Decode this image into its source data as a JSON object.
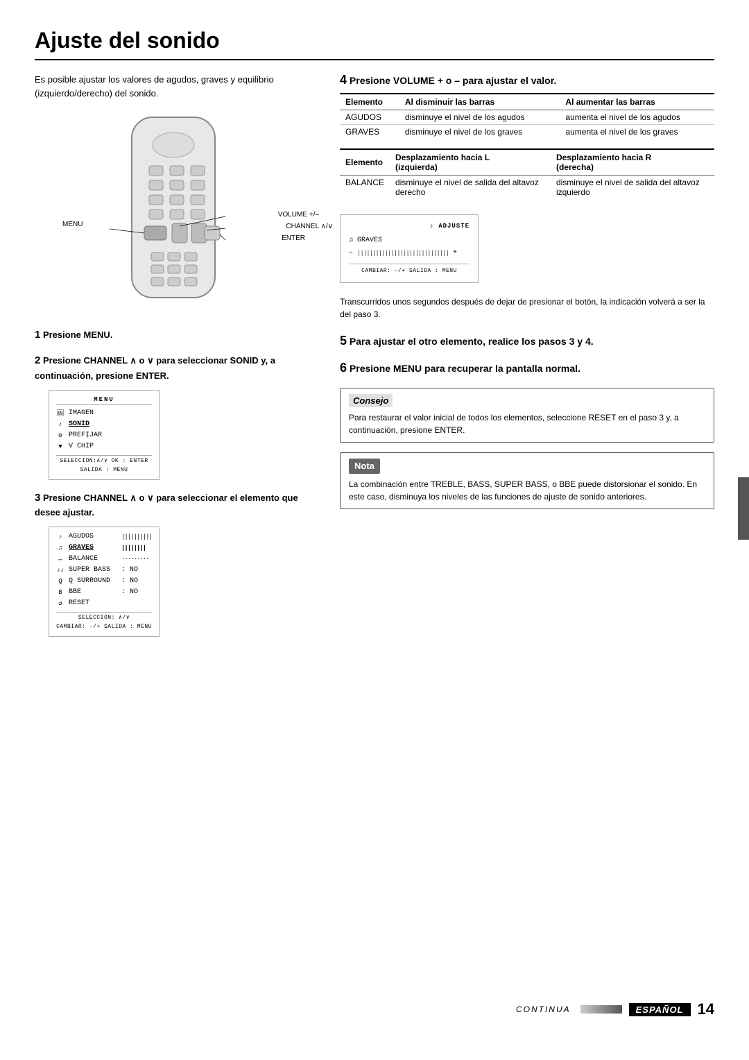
{
  "page": {
    "title": "Ajuste del sonido",
    "intro": "Es posible ajustar los valores de agudos, graves y equilibrio (izquierdo/derecho) del sonido.",
    "steps": [
      {
        "num": "1",
        "text": "Presione MENU."
      },
      {
        "num": "2",
        "text": "Presione CHANNEL",
        "text2": "o",
        "text3": "para seleccionar SONID y, a continuación, presione ENTER."
      },
      {
        "num": "3",
        "text": "Presione CHANNEL",
        "text2": "o",
        "text3": "para seleccionar el elemento que desee ajustar."
      },
      {
        "num": "4",
        "text": "Presione VOLUME + o – para ajustar el valor."
      },
      {
        "num": "5",
        "text": "Para ajustar el otro elemento, realice los pasos 3 y 4."
      },
      {
        "num": "6",
        "text": "Presione MENU para recuperar la pantalla normal."
      }
    ],
    "remote_labels": {
      "menu": "MENU",
      "volume": "VOLUME +/–",
      "channel": "CHANNEL ∧/∨",
      "enter": "ENTER"
    },
    "screen1": {
      "title": "MENU",
      "rows": [
        {
          "icon": "🖼",
          "label": "IMAGEN",
          "selected": false
        },
        {
          "icon": "♪",
          "label": "SONID",
          "selected": true
        },
        {
          "icon": "⚙",
          "label": "PREFỊJAR",
          "selected": false
        },
        {
          "icon": "▼",
          "label": "V CHIP",
          "selected": false
        }
      ],
      "footer": "SELECCION:∧/∨  OK : ENTER\nSALIDA : MENU"
    },
    "screen2": {
      "rows": [
        {
          "icon": "♪",
          "label": "AGUDOS",
          "bars": "||||||||||",
          "selected": false
        },
        {
          "icon": "♫",
          "label": "GRAVES",
          "bars": "||||||||",
          "selected": true
        },
        {
          "icon": "↔",
          "label": "BALANCE",
          "bars": "·········",
          "selected": false
        },
        {
          "icon": "♪♪",
          "label": "SUPER BASS",
          "value": ": NO",
          "selected": false
        },
        {
          "icon": "Q",
          "label": "Q SURROUND",
          "value": ": NO",
          "selected": false
        },
        {
          "icon": "B",
          "label": "BBE",
          "value": ": NO",
          "selected": false
        },
        {
          "icon": "↺",
          "label": "RESET",
          "value": "",
          "selected": false
        }
      ],
      "footer1": "SELECCION: ∧/∨",
      "footer2": "CAMBIAR: –/+  SALIDA : MENU"
    },
    "table1": {
      "cols": [
        "Elemento",
        "Al disminuir las barras",
        "Al aumentar las barras"
      ],
      "rows": [
        [
          "AGUDOS",
          "disminuye el nivel de los agudos",
          "aumenta el nivel de los agudos"
        ],
        [
          "GRAVES",
          "disminuye el nivel de los graves",
          "aumenta el nivel de los graves"
        ]
      ]
    },
    "table2": {
      "cols": [
        "Elemento",
        "Desplazamiento hacia L (izquierda)",
        "Desplazamiento hacia R (derecha)"
      ],
      "rows": [
        [
          "BALANCE",
          "disminuye el nivel de salida del altavoz derecho",
          "disminuye el nivel de salida del altavoz izquierdo"
        ]
      ]
    },
    "sound_screen": {
      "title": "ADJUSTE",
      "label": "GRAVES",
      "bar_minus": "–",
      "bar_content": "||||||||||||||||||||||||||||",
      "bar_plus": "+",
      "footer": "CAMBIAR: –/+  SALIDA : MENU"
    },
    "after_step4": "Transcurridos unos segundos después de dejar de presionar el botón, la indicación volverá a ser la del paso 3.",
    "consejo": {
      "title": "Consejo",
      "text": "Para restaurar el valor inicial de todos los elementos, seleccione RESET en el paso 3 y, a continuación, presione ENTER."
    },
    "nota": {
      "title": "Nota",
      "text": "La combinación entre TREBLE, BASS, SUPER BASS, o BBE puede distorsionar el sonido. En este caso, disminuya los niveles de las funciones de ajuste de sonido anteriores."
    },
    "footer": {
      "continua": "CONTINUA",
      "espanol": "ESPAÑOL",
      "page_num": "14"
    }
  }
}
